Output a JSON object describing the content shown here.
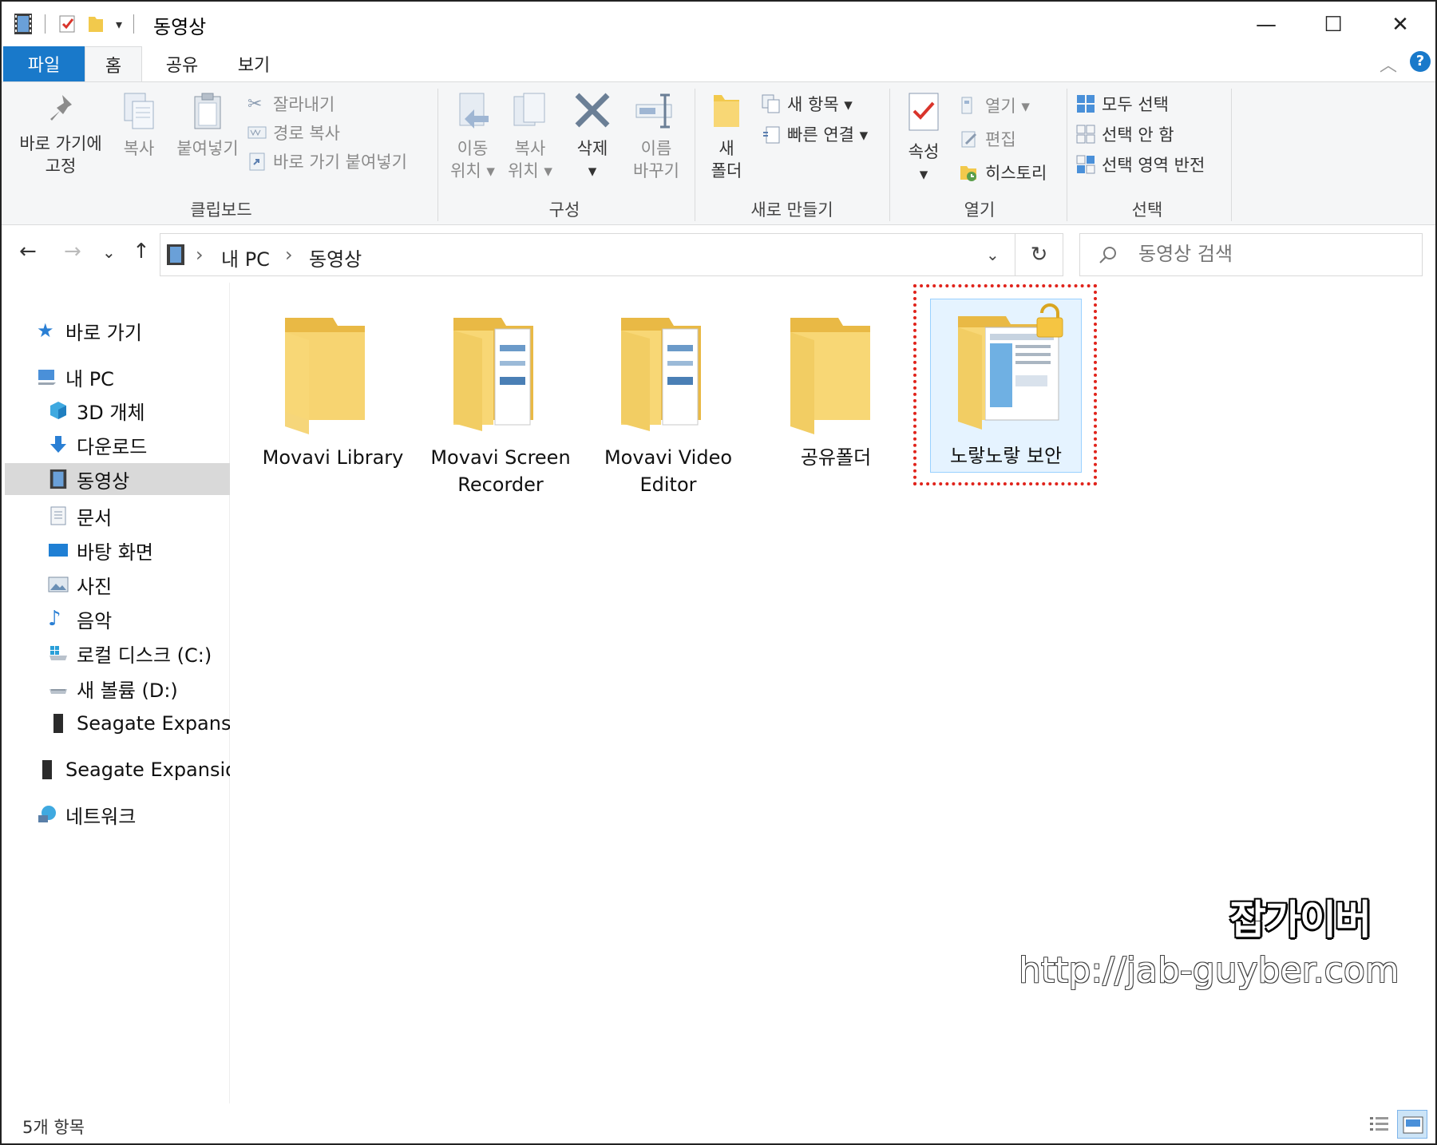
{
  "window": {
    "title": "동영상",
    "minimize": "—",
    "maximize": "☐",
    "close": "✕"
  },
  "tabs": {
    "file": "파일",
    "home": "홈",
    "share": "공유",
    "view": "보기"
  },
  "ribbon": {
    "clipboard": {
      "label": "클립보드",
      "pin": [
        "바로 가기에",
        "고정"
      ],
      "copy": "복사",
      "paste": "붙여넣기",
      "cut": "잘라내기",
      "copy_path": "경로 복사",
      "paste_shortcut": "바로 가기 붙여넣기"
    },
    "organize": {
      "label": "구성",
      "move": [
        "이동",
        "위치 ▾"
      ],
      "copyto": [
        "복사",
        "위치 ▾"
      ],
      "delete": [
        "삭제",
        "▾"
      ],
      "rename": [
        "이름",
        "바꾸기"
      ]
    },
    "new": {
      "label": "새로 만들기",
      "new_folder": [
        "새",
        "폴더"
      ],
      "new_item": "새 항목 ▾",
      "easy_access": "빠른 연결 ▾"
    },
    "open": {
      "label": "열기",
      "properties": [
        "속성",
        "▾"
      ],
      "open": "열기 ▾",
      "edit": "편집",
      "history": "히스토리"
    },
    "select": {
      "label": "선택",
      "select_all": "모두 선택",
      "select_none": "선택 안 함",
      "invert": "선택 영역 반전"
    }
  },
  "address": {
    "crumbs": [
      "내 PC",
      "동영상"
    ],
    "search_placeholder": "동영상 검색"
  },
  "nav": {
    "quick_access": "바로 가기",
    "this_pc": "내 PC",
    "objects3d": "3D 개체",
    "downloads": "다운로드",
    "videos": "동영상",
    "documents": "문서",
    "desktop": "바탕 화면",
    "pictures": "사진",
    "music": "음악",
    "local_c": "로컬 디스크 (C:)",
    "vol_d": "새 볼륨 (D:)",
    "seagate1": "Seagate Expansion",
    "seagate2": "Seagate Expansion",
    "network": "네트워크"
  },
  "folders": [
    {
      "line1": "Movavi Library",
      "line2": ""
    },
    {
      "line1": "Movavi Screen",
      "line2": "Recorder"
    },
    {
      "line1": "Movavi Video",
      "line2": "Editor"
    },
    {
      "line1": "공유폴더",
      "line2": ""
    },
    {
      "line1": "노랗노랗 보안",
      "line2": ""
    }
  ],
  "status": {
    "count": "5개 항목"
  },
  "watermark": {
    "name": "잡가이버",
    "url": "http://jab-guyber.com"
  },
  "colors": {
    "accent": "#1979ca",
    "folder": "#f8d775",
    "highlight": "#e0231b"
  }
}
